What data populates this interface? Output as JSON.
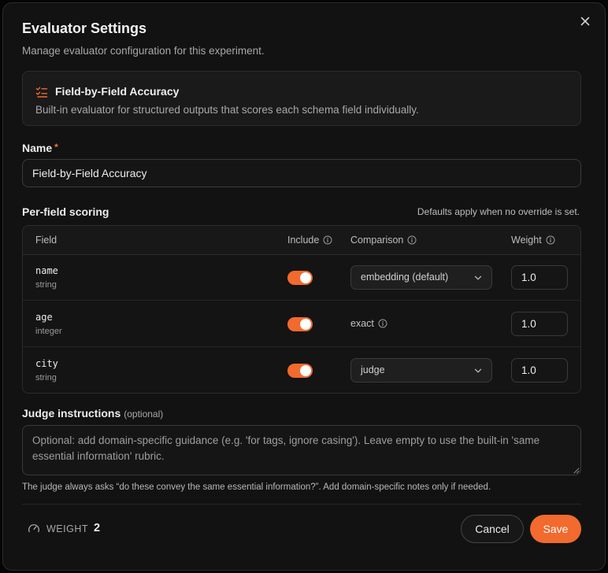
{
  "dialog": {
    "title": "Evaluator Settings",
    "subtitle": "Manage evaluator configuration for this experiment.",
    "close_icon": "x-icon"
  },
  "evaluator_card": {
    "icon": "checklist-icon",
    "name": "Field-by-Field Accuracy",
    "description": "Built-in evaluator for structured outputs that scores each schema field individually."
  },
  "name_field": {
    "label": "Name",
    "required_marker": "*",
    "value": "Field-by-Field Accuracy"
  },
  "per_field": {
    "label": "Per-field scoring",
    "note": "Defaults apply when no override is set.",
    "columns": {
      "field": "Field",
      "include": "Include",
      "comparison": "Comparison",
      "weight": "Weight"
    },
    "rows": [
      {
        "name": "name",
        "type": "string",
        "include": true,
        "comparison": "embedding (default)",
        "comparison_kind": "select",
        "weight": "1.0"
      },
      {
        "name": "age",
        "type": "integer",
        "include": true,
        "comparison": "exact",
        "comparison_kind": "static",
        "weight": "1.0"
      },
      {
        "name": "city",
        "type": "string",
        "include": true,
        "comparison": "judge",
        "comparison_kind": "select",
        "weight": "1.0"
      }
    ]
  },
  "judge": {
    "label": "Judge instructions",
    "optional": "(optional)",
    "placeholder": "Optional: add domain-specific guidance (e.g. 'for tags, ignore casing'). Leave empty to use the built-in 'same essential information' rubric.",
    "help": "The judge always asks “do these convey the same essential information?”. Add domain-specific notes only if needed."
  },
  "footer": {
    "weight_icon": "gauge-icon",
    "weight_label": "WEIGHT",
    "weight_value": "2",
    "cancel_label": "Cancel",
    "save_label": "Save"
  },
  "colors": {
    "accent": "#f26a2e",
    "background": "#121212",
    "card": "#1a1a1a",
    "border": "#2c2c2c"
  }
}
